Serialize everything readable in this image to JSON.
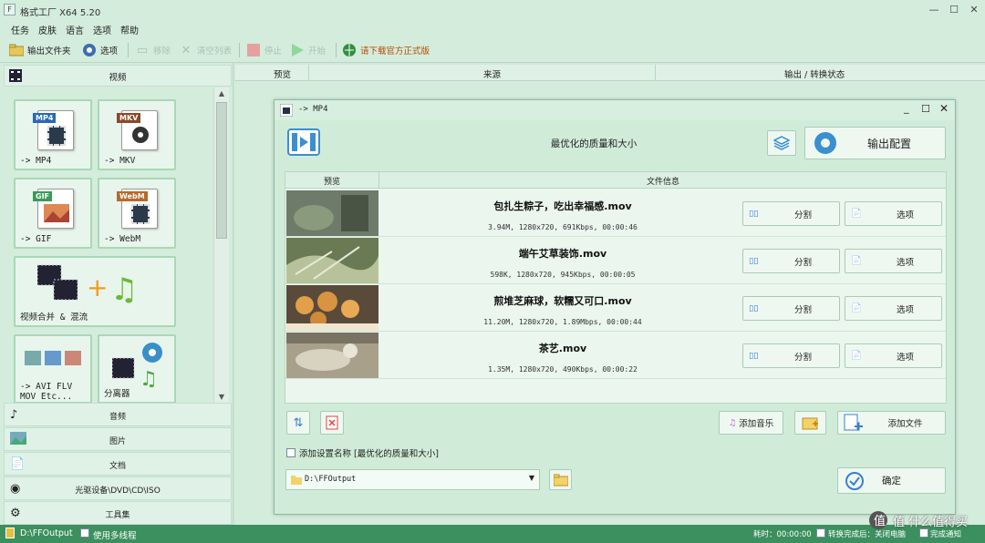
{
  "window": {
    "title": "格式工厂 X64 5.20",
    "minimize": "—",
    "maximize": "☐",
    "close": "✕"
  },
  "menu": [
    "任务",
    "皮肤",
    "语言",
    "选项",
    "帮助"
  ],
  "toolbar": {
    "output_folder": "输出文件夹",
    "options": "选项",
    "remove": "移除",
    "clear_list": "清空列表",
    "stop": "停止",
    "start": "开始",
    "download_official": "请下载官方正式版"
  },
  "left": {
    "header": "视频",
    "tiles": [
      {
        "tag": "MP4",
        "label": "-> MP4"
      },
      {
        "tag": "MKV",
        "label": "-> MKV"
      },
      {
        "tag": "GIF",
        "label": "-> GIF"
      },
      {
        "tag": "WebM",
        "label": "-> WebM"
      },
      {
        "label": "视频合并 & 混流"
      },
      {
        "label1": "-> AVI FLV",
        "label2": "MOV Etc..."
      },
      {
        "label": "分离器"
      }
    ],
    "categories": [
      "音频",
      "图片",
      "文档",
      "光驱设备\\DVD\\CD\\ISO",
      "工具集"
    ]
  },
  "columns": {
    "preview": "预览",
    "source": "来源",
    "output": "输出 / 转换状态"
  },
  "dialog": {
    "title": "-> MP4",
    "quality": "最优化的质量和大小",
    "output_config": "输出配置",
    "table_headers": {
      "preview": "预览",
      "info": "文件信息"
    },
    "files": [
      {
        "name": "包扎生粽子，吃出幸福感.mov",
        "meta": "3.94M, 1280x720, 691Kbps, 00:00:46"
      },
      {
        "name": "端午艾草装饰.mov",
        "meta": "598K, 1280x720, 945Kbps, 00:00:05"
      },
      {
        "name": "煎堆芝麻球，软糯又可口.mov",
        "meta": "11.20M, 1280x720, 1.89Mbps, 00:00:44"
      },
      {
        "name": "茶艺.mov",
        "meta": "1.35M, 1280x720, 490Kbps, 00:00:22"
      }
    ],
    "split_label": "分割",
    "options_label": "选项",
    "add_music": "添加音乐",
    "add_file": "添加文件",
    "add_setting_name": "添加设置名称 [最优化的质量和大小]",
    "output_path": "D:\\FFOutput",
    "ok": "确定"
  },
  "status": {
    "path": "D:\\FFOutput",
    "multithread": "使用多线程",
    "elapsed": "耗时：00:00:00",
    "after_convert": "转换完成后：关闭电脑",
    "notify": "完成通知",
    "watermark": "值 什么值得买"
  }
}
